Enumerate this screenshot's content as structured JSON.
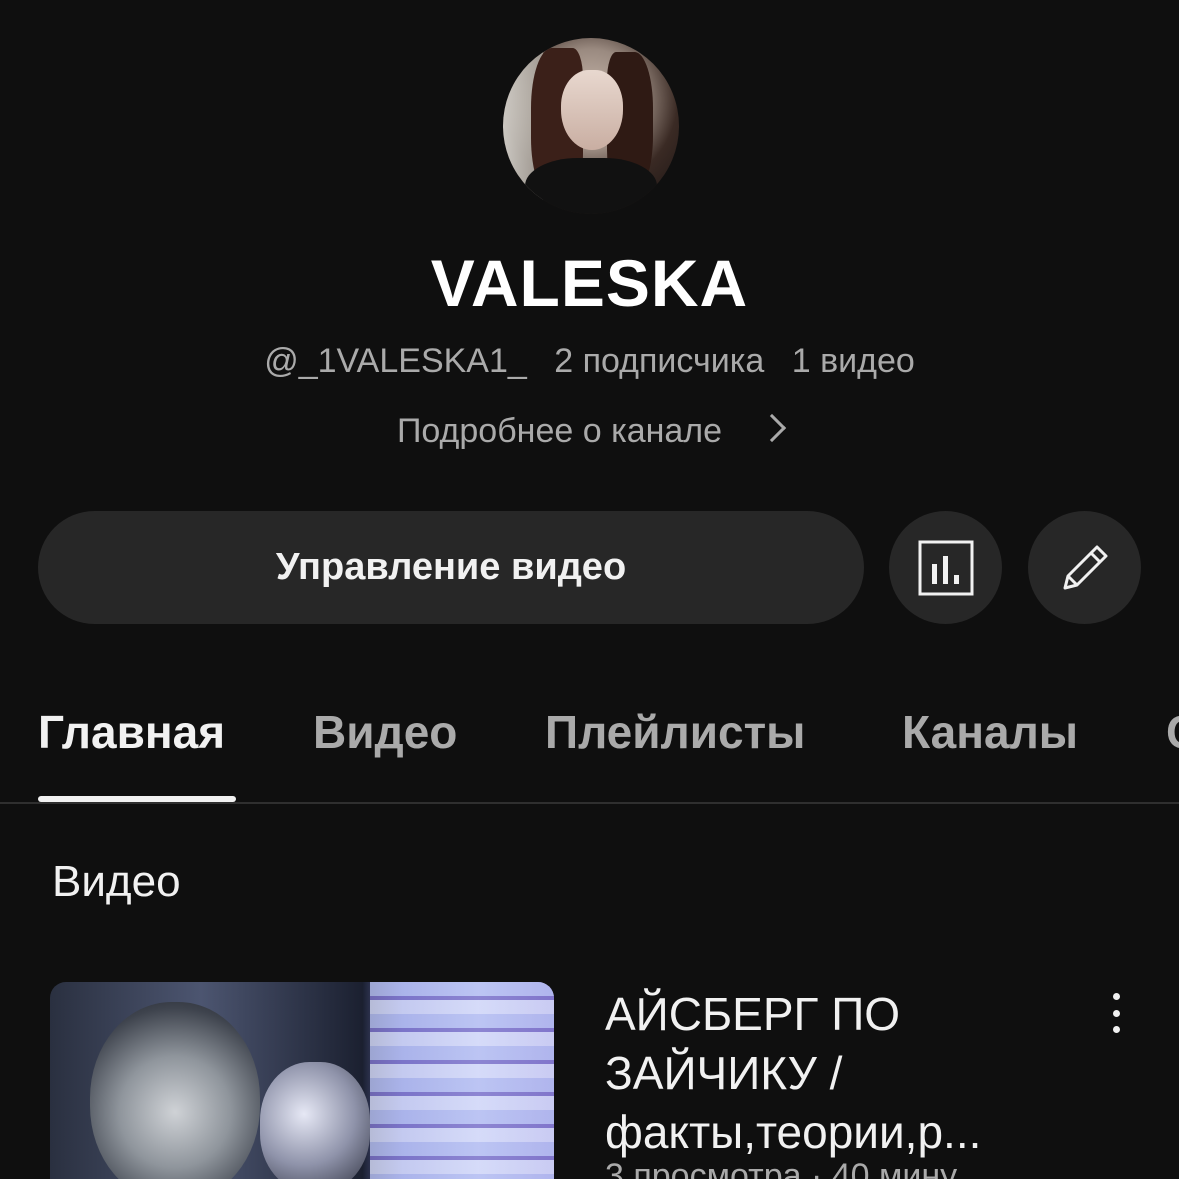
{
  "channel": {
    "name": "VALESKA",
    "handle": "@_1VALESKA1_",
    "subscribers": "2 подписчика",
    "videos_count": "1 видео",
    "about_link": "Подробнее о канале"
  },
  "actions": {
    "manage_label": "Управление видео",
    "analytics_icon": "analytics-icon",
    "edit_icon": "pencil-icon"
  },
  "tabs": [
    {
      "label": "Главная",
      "active": true
    },
    {
      "label": "Видео",
      "active": false
    },
    {
      "label": "Плейлисты",
      "active": false
    },
    {
      "label": "Каналы",
      "active": false
    },
    {
      "label": "С",
      "active": false
    }
  ],
  "section": {
    "title": "Видео"
  },
  "video": {
    "title_lines": [
      "АЙСБЕРГ ПО",
      "ЗАЙЧИКУ /",
      "факты,теории,р..."
    ],
    "meta": "3 просмотра · 40 мину"
  }
}
